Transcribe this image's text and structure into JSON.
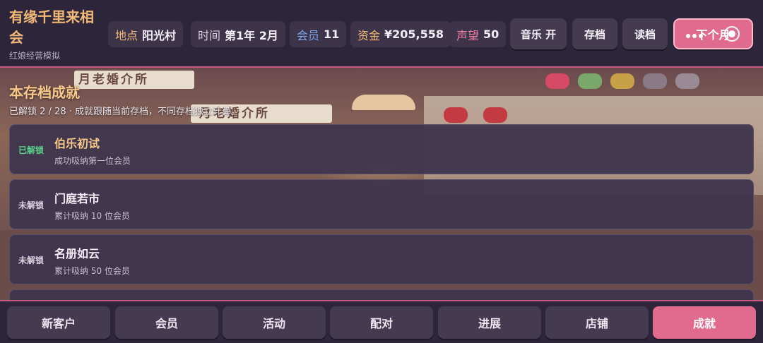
{
  "header": {
    "title": "有缘千里来相会",
    "subtitle": "红娘经营模拟",
    "stats": {
      "location_label": "地点",
      "location_value": "阳光村",
      "time_label": "时间",
      "time_value": "第1年 2月",
      "members_label": "会员",
      "members_value": "11",
      "funds_label": "资金",
      "funds_value": "¥205,558",
      "reputation_label": "声望",
      "reputation_value": "50"
    },
    "buttons": {
      "music": "音乐 开",
      "save": "存档",
      "load": "读档",
      "next_month": "下个月"
    }
  },
  "background": {
    "sign_text": "月老婚介所",
    "sign_text_2": "月老婚介所"
  },
  "achievements": {
    "title": "本存档成就",
    "summary": "已解锁 2 / 28 · 成就跟随当前存档，不同存档独立计算。",
    "items": [
      {
        "state": "已解锁",
        "name": "伯乐初试",
        "desc": "成功吸纳第一位会员",
        "unlocked": true
      },
      {
        "state": "未解锁",
        "name": "门庭若市",
        "desc": "累计吸纳 10 位会员",
        "unlocked": false
      },
      {
        "state": "未解锁",
        "name": "名册如云",
        "desc": "累计吸纳 50 位会员",
        "unlocked": false
      }
    ]
  },
  "bottom_nav": {
    "items": [
      "新客户",
      "会员",
      "活动",
      "配对",
      "进展",
      "店铺",
      "成就"
    ],
    "active": "成就"
  },
  "colors": {
    "accent": "#e06b8e",
    "title": "#f0b877",
    "unlocked": "#58d08a"
  }
}
